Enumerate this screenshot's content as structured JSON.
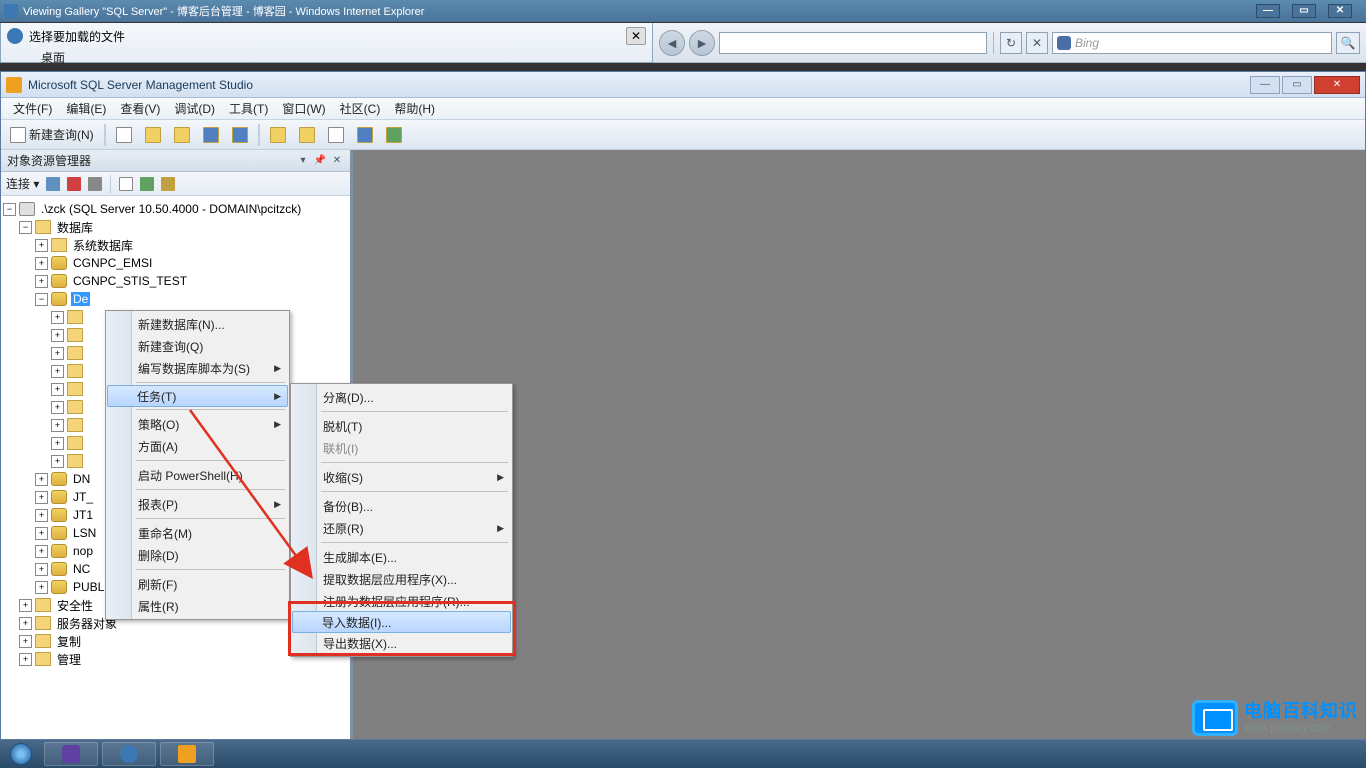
{
  "ie_window": {
    "title": "Viewing Gallery \"SQL Server\" - 博客后台管理 - 博客园 - Windows Internet Explorer",
    "min": "—",
    "max": "▭",
    "close": "✕"
  },
  "file_dialog": {
    "title": "选择要加载的文件",
    "close": "✕",
    "tab_desktop": "桌面"
  },
  "ie_toolbar": {
    "back": "◄",
    "fwd": "►",
    "refresh": "↻",
    "stop": "✕",
    "search_placeholder": "Bing",
    "go": "🔍"
  },
  "ssms": {
    "title": "Microsoft SQL Server Management Studio",
    "min": "—",
    "max": "▭",
    "close": "✕",
    "menu": [
      "文件(F)",
      "编辑(E)",
      "查看(V)",
      "调试(D)",
      "工具(T)",
      "窗口(W)",
      "社区(C)",
      "帮助(H)"
    ],
    "new_query": "新建查询(N)"
  },
  "oe": {
    "header": "对象资源管理器",
    "pin": "▾",
    "auto": "📌",
    "close": "✕",
    "connect": "连接 ▾"
  },
  "tree": {
    "root": ".\\zck (SQL Server 10.50.4000 - DOMAIN\\pcitzck)",
    "databases": "数据库",
    "sysdb": "系统数据库",
    "db1": "CGNPC_EMSI",
    "db2": "CGNPC_STIS_TEST",
    "db3": "De",
    "db4": "DN",
    "db5": "JT_",
    "db6": "JT1",
    "db7": "LSN",
    "db8": "nop",
    "db9": "NC",
    "db10": "PUBLIC",
    "security": "安全性",
    "server_objects": "服务器对象",
    "replication": "复制",
    "management": "管理"
  },
  "ctx1": {
    "items": [
      {
        "t": "新建数据库(N)...",
        "sub": false
      },
      {
        "t": "新建查询(Q)",
        "sub": false
      },
      {
        "t": "编写数据库脚本为(S)",
        "sub": true
      },
      {
        "sep": true
      },
      {
        "t": "任务(T)",
        "sub": true,
        "hl": true
      },
      {
        "sep": true
      },
      {
        "t": "策略(O)",
        "sub": true
      },
      {
        "t": "方面(A)",
        "sub": false
      },
      {
        "sep": true
      },
      {
        "t": "启动 PowerShell(H)",
        "sub": false
      },
      {
        "sep": true
      },
      {
        "t": "报表(P)",
        "sub": true
      },
      {
        "sep": true
      },
      {
        "t": "重命名(M)",
        "sub": false
      },
      {
        "t": "删除(D)",
        "sub": false
      },
      {
        "sep": true
      },
      {
        "t": "刷新(F)",
        "sub": false
      },
      {
        "t": "属性(R)",
        "sub": false
      }
    ]
  },
  "ctx2": {
    "items": [
      {
        "t": "分离(D)...",
        "sub": false
      },
      {
        "sep": true
      },
      {
        "t": "脱机(T)",
        "sub": false
      },
      {
        "t": "联机(I)",
        "sub": false,
        "disabled": true
      },
      {
        "sep": true
      },
      {
        "t": "收缩(S)",
        "sub": true
      },
      {
        "sep": true
      },
      {
        "t": "备份(B)...",
        "sub": false
      },
      {
        "t": "还原(R)",
        "sub": true
      },
      {
        "sep": true
      },
      {
        "t": "生成脚本(E)...",
        "sub": false
      },
      {
        "t": "提取数据层应用程序(X)...",
        "sub": false
      },
      {
        "t": "注册为数据层应用程序(R)...",
        "sub": false
      },
      {
        "t": "导入数据(I)...",
        "sub": false,
        "hl": true
      },
      {
        "t": "导出数据(X)...",
        "sub": false
      }
    ]
  },
  "watermark": {
    "cn": "电脑百科知识",
    "en": "www.pc-daily.com"
  }
}
